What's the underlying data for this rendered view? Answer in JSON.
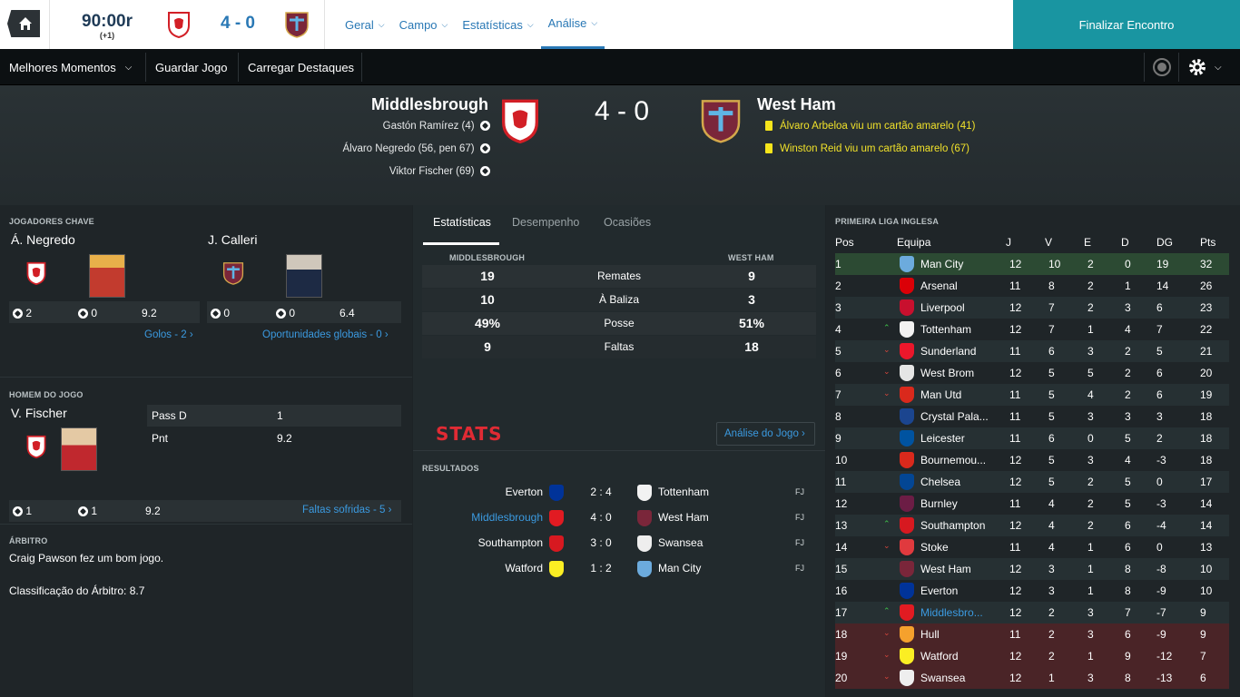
{
  "topbar": {
    "clock": "90:00r",
    "added": "(+1)",
    "score": "4 - 0",
    "nav": [
      "Geral",
      "Campo",
      "Estatísticas",
      "Análise"
    ],
    "active_nav": "Análise",
    "finish": "Finalizar Encontro"
  },
  "subbar": {
    "highlights": "Melhores Momentos",
    "save": "Guardar Jogo",
    "load": "Carregar Destaques"
  },
  "match": {
    "home": "Middlesbrough",
    "away": "West Ham",
    "score": "4 - 0",
    "home_scorers": [
      "Gastón Ramírez (4)",
      "Álvaro Negredo (56, pen 67)",
      "Viktor Fischer (69)"
    ],
    "away_events": [
      "Álvaro Arbeloa viu um cartão amarelo (41)",
      "Winston Reid viu um cartão amarelo (67)"
    ]
  },
  "key_players": {
    "title": "JOGADORES CHAVE",
    "p1": {
      "name": "Á. Negredo",
      "goals": "2",
      "assists": "0",
      "rating": "9.2",
      "link": "Golos - 2"
    },
    "p2": {
      "name": "J. Calleri",
      "goals": "0",
      "assists": "0",
      "rating": "6.4",
      "link": "Oportunidades globais - 0"
    }
  },
  "motm": {
    "title": "HOMEM DO JOGO",
    "name": "V. Fischer",
    "stat1_label": "Pass D",
    "stat1_value": "1",
    "stat2_label": "Pnt",
    "stat2_value": "9.2",
    "goals": "1",
    "assists": "1",
    "rating": "9.2",
    "link": "Faltas sofridas - 5"
  },
  "referee": {
    "title": "ÁRBITRO",
    "line1": "Craig Pawson fez um bom jogo.",
    "line2": "Classificação do Árbitro: 8.7"
  },
  "stats": {
    "tabs": [
      "Estatísticas",
      "Desempenho",
      "Ocasiões"
    ],
    "home_label": "MIDDLESBROUGH",
    "away_label": "WEST HAM",
    "rows": [
      {
        "home": "19",
        "label": "Remates",
        "away": "9"
      },
      {
        "home": "10",
        "label": "À Baliza",
        "away": "3"
      },
      {
        "home": "49%",
        "label": "Posse",
        "away": "51%"
      },
      {
        "home": "9",
        "label": "Faltas",
        "away": "18"
      }
    ],
    "logo": "STATS",
    "analysis_link": "Análise do Jogo"
  },
  "results": {
    "title": "RESULTADOS",
    "rows": [
      {
        "home": "Everton",
        "score": "2 : 4",
        "away": "Tottenham",
        "status": "FJ"
      },
      {
        "home": "Middlesbrough",
        "score": "4 : 0",
        "away": "West Ham",
        "status": "FJ"
      },
      {
        "home": "Southampton",
        "score": "3 : 0",
        "away": "Swansea",
        "status": "FJ"
      },
      {
        "home": "Watford",
        "score": "1 : 2",
        "away": "Man City",
        "status": "FJ"
      }
    ]
  },
  "league": {
    "title": "PRIMEIRA LIGA INGLESA",
    "headers": [
      "Pos",
      "Equipa",
      "J",
      "V",
      "E",
      "D",
      "DG",
      "Pts"
    ],
    "rows": [
      {
        "pos": "1",
        "move": "",
        "team": "Man City",
        "j": "12",
        "v": "10",
        "e": "2",
        "d": "0",
        "dg": "19",
        "pts": "32",
        "color": "#6cabdd"
      },
      {
        "pos": "2",
        "move": "",
        "team": "Arsenal",
        "j": "11",
        "v": "8",
        "e": "2",
        "d": "1",
        "dg": "14",
        "pts": "26",
        "color": "#db0007"
      },
      {
        "pos": "3",
        "move": "",
        "team": "Liverpool",
        "j": "12",
        "v": "7",
        "e": "2",
        "d": "3",
        "dg": "6",
        "pts": "23",
        "color": "#c8102e"
      },
      {
        "pos": "4",
        "move": "up",
        "team": "Tottenham",
        "j": "12",
        "v": "7",
        "e": "1",
        "d": "4",
        "dg": "7",
        "pts": "22",
        "color": "#f2f2f2"
      },
      {
        "pos": "5",
        "move": "down",
        "team": "Sunderland",
        "j": "11",
        "v": "6",
        "e": "3",
        "d": "2",
        "dg": "5",
        "pts": "21",
        "color": "#eb172b"
      },
      {
        "pos": "6",
        "move": "down",
        "team": "West Brom",
        "j": "12",
        "v": "5",
        "e": "5",
        "d": "2",
        "dg": "6",
        "pts": "20",
        "color": "#e5e5e5"
      },
      {
        "pos": "7",
        "move": "down",
        "team": "Man Utd",
        "j": "11",
        "v": "5",
        "e": "4",
        "d": "2",
        "dg": "6",
        "pts": "19",
        "color": "#da291c"
      },
      {
        "pos": "8",
        "move": "",
        "team": "Crystal Pala...",
        "j": "11",
        "v": "5",
        "e": "3",
        "d": "3",
        "dg": "3",
        "pts": "18",
        "color": "#1b458f"
      },
      {
        "pos": "9",
        "move": "",
        "team": "Leicester",
        "j": "11",
        "v": "6",
        "e": "0",
        "d": "5",
        "dg": "2",
        "pts": "18",
        "color": "#0053a0"
      },
      {
        "pos": "10",
        "move": "",
        "team": "Bournemou...",
        "j": "12",
        "v": "5",
        "e": "3",
        "d": "4",
        "dg": "-3",
        "pts": "18",
        "color": "#da291c"
      },
      {
        "pos": "11",
        "move": "",
        "team": "Chelsea",
        "j": "12",
        "v": "5",
        "e": "2",
        "d": "5",
        "dg": "0",
        "pts": "17",
        "color": "#034694"
      },
      {
        "pos": "12",
        "move": "",
        "team": "Burnley",
        "j": "11",
        "v": "4",
        "e": "2",
        "d": "5",
        "dg": "-3",
        "pts": "14",
        "color": "#6c1d45"
      },
      {
        "pos": "13",
        "move": "up",
        "team": "Southampton",
        "j": "12",
        "v": "4",
        "e": "2",
        "d": "6",
        "dg": "-4",
        "pts": "14",
        "color": "#d71920"
      },
      {
        "pos": "14",
        "move": "down",
        "team": "Stoke",
        "j": "11",
        "v": "4",
        "e": "1",
        "d": "6",
        "dg": "0",
        "pts": "13",
        "color": "#e03a3e"
      },
      {
        "pos": "15",
        "move": "",
        "team": "West Ham",
        "j": "12",
        "v": "3",
        "e": "1",
        "d": "8",
        "dg": "-8",
        "pts": "10",
        "color": "#7a263a"
      },
      {
        "pos": "16",
        "move": "",
        "team": "Everton",
        "j": "12",
        "v": "3",
        "e": "1",
        "d": "8",
        "dg": "-9",
        "pts": "10",
        "color": "#003399"
      },
      {
        "pos": "17",
        "move": "up",
        "team": "Middlesbro...",
        "j": "12",
        "v": "2",
        "e": "3",
        "d": "7",
        "dg": "-7",
        "pts": "9",
        "color": "#e11b22"
      },
      {
        "pos": "18",
        "move": "down",
        "team": "Hull",
        "j": "11",
        "v": "2",
        "e": "3",
        "d": "6",
        "dg": "-9",
        "pts": "9",
        "color": "#f5a12d"
      },
      {
        "pos": "19",
        "move": "down",
        "team": "Watford",
        "j": "12",
        "v": "2",
        "e": "1",
        "d": "9",
        "dg": "-12",
        "pts": "7",
        "color": "#fbee23"
      },
      {
        "pos": "20",
        "move": "down",
        "team": "Swansea",
        "j": "12",
        "v": "1",
        "e": "3",
        "d": "8",
        "dg": "-13",
        "pts": "6",
        "color": "#eeeeee"
      }
    ]
  },
  "colors": {
    "accent": "#2978b5",
    "finish_bg": "#1995a1",
    "link": "#3b9ae0",
    "card": "#f6e51b",
    "champions": "#2c4a33",
    "relegation": "#4a2427"
  }
}
